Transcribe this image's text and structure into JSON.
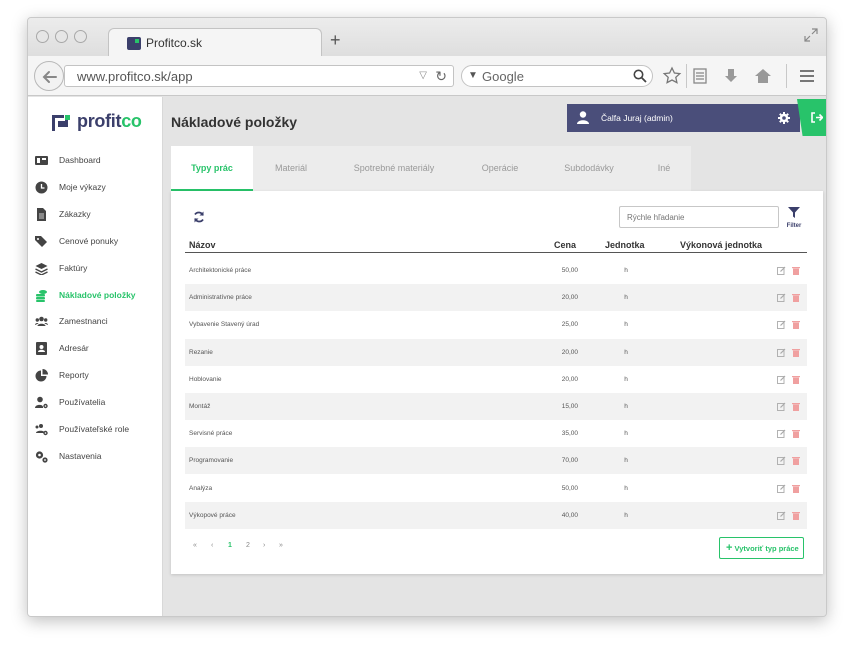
{
  "browser": {
    "tab_title": "Profitco.sk",
    "url": "www.profitco.sk/app",
    "search_placeholder": "Google"
  },
  "app": {
    "logo": {
      "main": "profit",
      "accent": "co"
    },
    "page_title": "Nákladové položky",
    "user": {
      "name": "Čalfa Juraj (admin)"
    },
    "sidebar": {
      "items": [
        {
          "label": "Dashboard",
          "icon": "dashboard-icon"
        },
        {
          "label": "Moje výkazy",
          "icon": "clock-icon"
        },
        {
          "label": "Zákazky",
          "icon": "document-icon"
        },
        {
          "label": "Cenové ponuky",
          "icon": "tags-icon"
        },
        {
          "label": "Faktúry",
          "icon": "layers-icon"
        },
        {
          "label": "Nákladové položky",
          "icon": "coins-icon",
          "active": true
        },
        {
          "label": "Zamestnanci",
          "icon": "users-icon"
        },
        {
          "label": "Adresár",
          "icon": "address-book-icon"
        },
        {
          "label": "Reporty",
          "icon": "pie-chart-icon"
        },
        {
          "label": "Používatelia",
          "icon": "user-cog-icon"
        },
        {
          "label": "Používateľské role",
          "icon": "users-cog-icon"
        },
        {
          "label": "Nastavenia",
          "icon": "cogs-icon"
        }
      ]
    },
    "tabs": [
      "Typy prác",
      "Materiál",
      "Spotrebné materiály",
      "Operácie",
      "Subdodávky",
      "Iné"
    ],
    "quick_search_placeholder": "Rýchle hľadanie",
    "filter_label": "Filter",
    "table": {
      "headers": {
        "name": "Názov",
        "price": "Cena",
        "unit": "Jednotka",
        "perf_unit": "Výkonová jednotka"
      },
      "rows": [
        {
          "name": "Architektonické práce",
          "price": "50,00",
          "unit": "h"
        },
        {
          "name": "Administratívne práce",
          "price": "20,00",
          "unit": "h"
        },
        {
          "name": "Vybavenie Stavený úrad",
          "price": "25,00",
          "unit": "h"
        },
        {
          "name": "Rezanie",
          "price": "20,00",
          "unit": "h"
        },
        {
          "name": "Hoblovanie",
          "price": "20,00",
          "unit": "h"
        },
        {
          "name": "Montáž",
          "price": "15,00",
          "unit": "h"
        },
        {
          "name": "Servisné práce",
          "price": "35,00",
          "unit": "h"
        },
        {
          "name": "Programovanie",
          "price": "70,00",
          "unit": "h"
        },
        {
          "name": "Analýza",
          "price": "50,00",
          "unit": "h"
        },
        {
          "name": "Výkopové práce",
          "price": "40,00",
          "unit": "h"
        }
      ]
    },
    "pagination": {
      "first": "«",
      "prev": "‹",
      "pages": [
        "1",
        "2"
      ],
      "current": "1",
      "next": "›",
      "last": "»"
    },
    "create_button": "Vytvoriť typ práce",
    "colors": {
      "accent": "#28c36a",
      "brand": "#4a4e7a"
    }
  }
}
